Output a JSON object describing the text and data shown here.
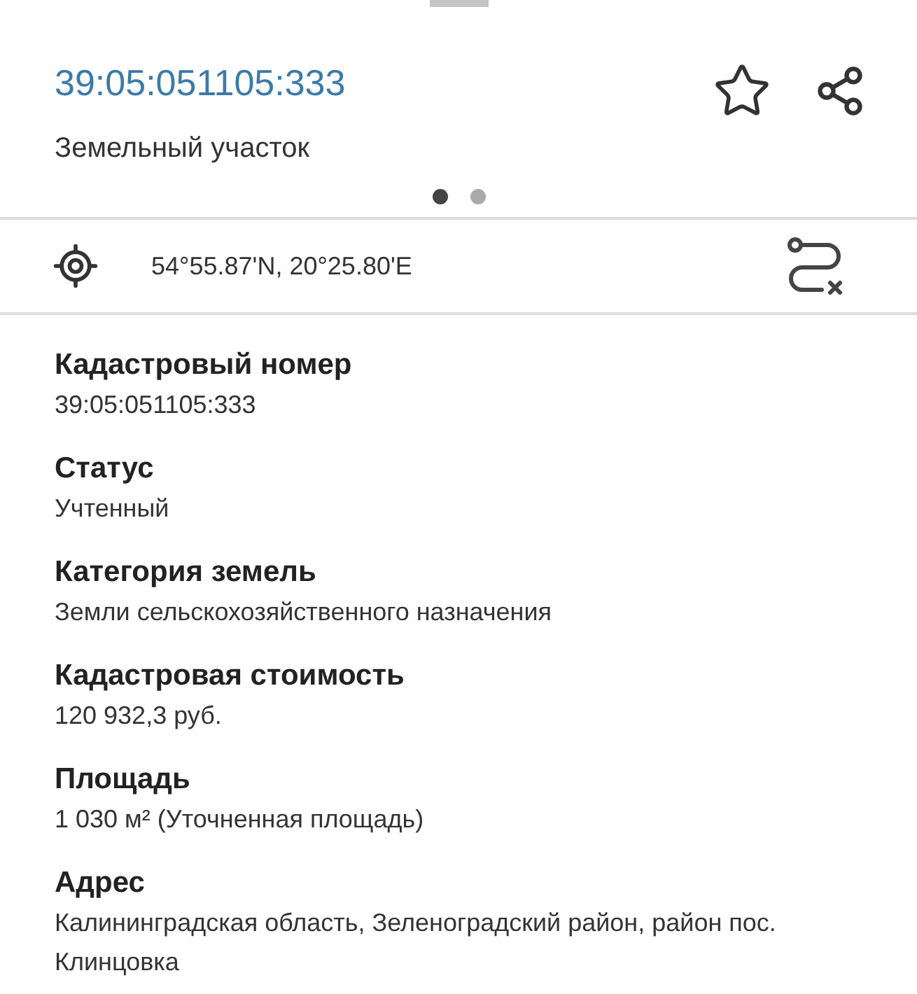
{
  "header": {
    "title": "39:05:051105:333",
    "subtitle": "Земельный участок"
  },
  "pager": [
    {
      "selected": true
    },
    {
      "selected": false
    }
  ],
  "coordinates": "54°55.87'N, 20°25.80'E",
  "fields": [
    {
      "label": "Кадастровый номер",
      "value": "39:05:051105:333"
    },
    {
      "label": "Статус",
      "value": "Учтенный"
    },
    {
      "label": "Категория земель",
      "value": "Земли сельскохозяйственного назначения"
    },
    {
      "label": "Кадастровая стоимость",
      "value": "120 932,3 руб."
    },
    {
      "label": "Площадь",
      "value": "1 030 м² (Уточненная площадь)"
    },
    {
      "label": "Адрес",
      "value": "Калининградская область, Зеленоградский район, район пос. Клинцовка"
    }
  ]
}
